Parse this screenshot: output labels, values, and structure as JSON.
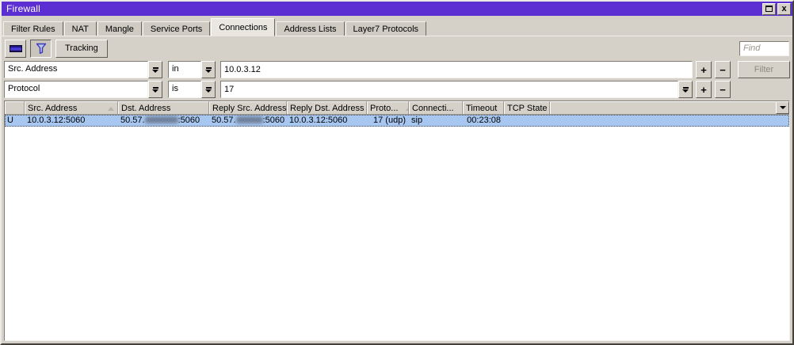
{
  "window": {
    "title": "Firewall"
  },
  "colors": {
    "titlebar": "#5b2fd2",
    "chrome": "#d5d1c9",
    "selected_row": "#a8c7f0"
  },
  "tabs": [
    {
      "label": "Filter Rules",
      "active": false
    },
    {
      "label": "NAT",
      "active": false
    },
    {
      "label": "Mangle",
      "active": false
    },
    {
      "label": "Service Ports",
      "active": false
    },
    {
      "label": "Connections",
      "active": true
    },
    {
      "label": "Address Lists",
      "active": false
    },
    {
      "label": "Layer7 Protocols",
      "active": false
    }
  ],
  "toolbar": {
    "tracking_label": "Tracking",
    "find_placeholder": "Find"
  },
  "filter_row_1": {
    "field": "Src. Address",
    "operator": "in",
    "value": "10.0.3.12",
    "add_label": "+",
    "remove_label": "−",
    "filter_label": "Filter"
  },
  "filter_row_2": {
    "field": "Protocol",
    "operator": "is",
    "value": "17",
    "add_label": "+",
    "remove_label": "−"
  },
  "table": {
    "columns": [
      "",
      "Src. Address",
      "Dst. Address",
      "Reply Src. Address",
      "Reply Dst. Address",
      "Proto...",
      "Connecti...",
      "Timeout",
      "TCP State"
    ],
    "row": {
      "flags": "U",
      "src_address": "10.0.3.12:5060",
      "dst_address_prefix": "50.57.",
      "dst_address_suffix": ":5060",
      "reply_src_prefix": "50.57.",
      "reply_src_suffix": ":5060",
      "reply_dst_address": "10.0.3.12:5060",
      "protocol": "17 (udp)",
      "connection_type": "sip",
      "timeout": "00:23:08",
      "tcp_state": ""
    }
  }
}
